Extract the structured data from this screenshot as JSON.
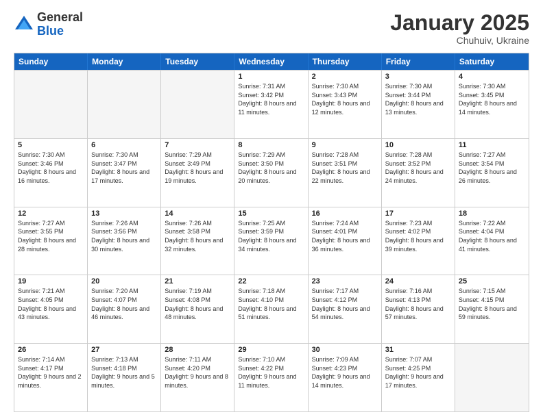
{
  "logo": {
    "general": "General",
    "blue": "Blue"
  },
  "header": {
    "month": "January 2025",
    "location": "Chuhuiv, Ukraine"
  },
  "weekdays": [
    "Sunday",
    "Monday",
    "Tuesday",
    "Wednesday",
    "Thursday",
    "Friday",
    "Saturday"
  ],
  "weeks": [
    [
      {
        "day": "",
        "empty": true
      },
      {
        "day": "",
        "empty": true
      },
      {
        "day": "",
        "empty": true
      },
      {
        "day": "1",
        "sunrise": "7:31 AM",
        "sunset": "3:42 PM",
        "daylight": "8 hours and 11 minutes."
      },
      {
        "day": "2",
        "sunrise": "7:30 AM",
        "sunset": "3:43 PM",
        "daylight": "8 hours and 12 minutes."
      },
      {
        "day": "3",
        "sunrise": "7:30 AM",
        "sunset": "3:44 PM",
        "daylight": "8 hours and 13 minutes."
      },
      {
        "day": "4",
        "sunrise": "7:30 AM",
        "sunset": "3:45 PM",
        "daylight": "8 hours and 14 minutes."
      }
    ],
    [
      {
        "day": "5",
        "sunrise": "7:30 AM",
        "sunset": "3:46 PM",
        "daylight": "8 hours and 16 minutes."
      },
      {
        "day": "6",
        "sunrise": "7:30 AM",
        "sunset": "3:47 PM",
        "daylight": "8 hours and 17 minutes."
      },
      {
        "day": "7",
        "sunrise": "7:29 AM",
        "sunset": "3:49 PM",
        "daylight": "8 hours and 19 minutes."
      },
      {
        "day": "8",
        "sunrise": "7:29 AM",
        "sunset": "3:50 PM",
        "daylight": "8 hours and 20 minutes."
      },
      {
        "day": "9",
        "sunrise": "7:28 AM",
        "sunset": "3:51 PM",
        "daylight": "8 hours and 22 minutes."
      },
      {
        "day": "10",
        "sunrise": "7:28 AM",
        "sunset": "3:52 PM",
        "daylight": "8 hours and 24 minutes."
      },
      {
        "day": "11",
        "sunrise": "7:27 AM",
        "sunset": "3:54 PM",
        "daylight": "8 hours and 26 minutes."
      }
    ],
    [
      {
        "day": "12",
        "sunrise": "7:27 AM",
        "sunset": "3:55 PM",
        "daylight": "8 hours and 28 minutes."
      },
      {
        "day": "13",
        "sunrise": "7:26 AM",
        "sunset": "3:56 PM",
        "daylight": "8 hours and 30 minutes."
      },
      {
        "day": "14",
        "sunrise": "7:26 AM",
        "sunset": "3:58 PM",
        "daylight": "8 hours and 32 minutes."
      },
      {
        "day": "15",
        "sunrise": "7:25 AM",
        "sunset": "3:59 PM",
        "daylight": "8 hours and 34 minutes."
      },
      {
        "day": "16",
        "sunrise": "7:24 AM",
        "sunset": "4:01 PM",
        "daylight": "8 hours and 36 minutes."
      },
      {
        "day": "17",
        "sunrise": "7:23 AM",
        "sunset": "4:02 PM",
        "daylight": "8 hours and 39 minutes."
      },
      {
        "day": "18",
        "sunrise": "7:22 AM",
        "sunset": "4:04 PM",
        "daylight": "8 hours and 41 minutes."
      }
    ],
    [
      {
        "day": "19",
        "sunrise": "7:21 AM",
        "sunset": "4:05 PM",
        "daylight": "8 hours and 43 minutes."
      },
      {
        "day": "20",
        "sunrise": "7:20 AM",
        "sunset": "4:07 PM",
        "daylight": "8 hours and 46 minutes."
      },
      {
        "day": "21",
        "sunrise": "7:19 AM",
        "sunset": "4:08 PM",
        "daylight": "8 hours and 48 minutes."
      },
      {
        "day": "22",
        "sunrise": "7:18 AM",
        "sunset": "4:10 PM",
        "daylight": "8 hours and 51 minutes."
      },
      {
        "day": "23",
        "sunrise": "7:17 AM",
        "sunset": "4:12 PM",
        "daylight": "8 hours and 54 minutes."
      },
      {
        "day": "24",
        "sunrise": "7:16 AM",
        "sunset": "4:13 PM",
        "daylight": "8 hours and 57 minutes."
      },
      {
        "day": "25",
        "sunrise": "7:15 AM",
        "sunset": "4:15 PM",
        "daylight": "8 hours and 59 minutes."
      }
    ],
    [
      {
        "day": "26",
        "sunrise": "7:14 AM",
        "sunset": "4:17 PM",
        "daylight": "9 hours and 2 minutes."
      },
      {
        "day": "27",
        "sunrise": "7:13 AM",
        "sunset": "4:18 PM",
        "daylight": "9 hours and 5 minutes."
      },
      {
        "day": "28",
        "sunrise": "7:11 AM",
        "sunset": "4:20 PM",
        "daylight": "9 hours and 8 minutes."
      },
      {
        "day": "29",
        "sunrise": "7:10 AM",
        "sunset": "4:22 PM",
        "daylight": "9 hours and 11 minutes."
      },
      {
        "day": "30",
        "sunrise": "7:09 AM",
        "sunset": "4:23 PM",
        "daylight": "9 hours and 14 minutes."
      },
      {
        "day": "31",
        "sunrise": "7:07 AM",
        "sunset": "4:25 PM",
        "daylight": "9 hours and 17 minutes."
      },
      {
        "day": "",
        "empty": true
      }
    ]
  ]
}
